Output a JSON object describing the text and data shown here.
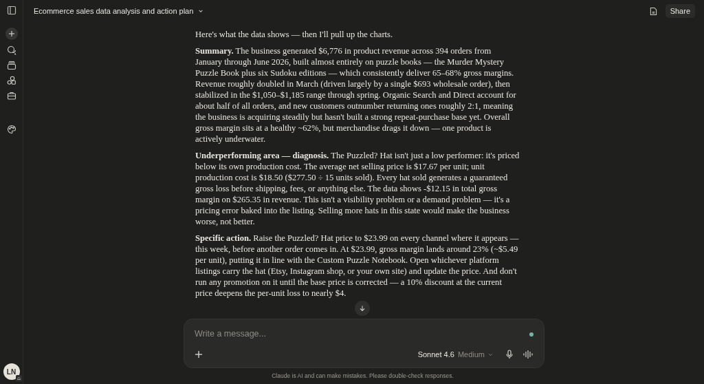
{
  "header": {
    "title": "Ecommerce sales data analysis and action plan",
    "share_label": "Share"
  },
  "sidebar": {
    "avatar_initials": "LN"
  },
  "message": {
    "paragraphs": [
      "Here's what the data shows — then I'll pull up the charts.",
      "**Summary.** The business generated $6,776 in product revenue across 394 orders from January through June 2026, built almost entirely on puzzle books — the Murder Mystery Puzzle Book plus six Sudoku editions — which consistently deliver 65–68% gross margins. Revenue roughly doubled in March (driven largely by a single $693 wholesale order), then stabilized in the $1,050–$1,185 range through spring. Organic Search and Direct account for about half of all orders, and new customers outnumber returning ones roughly 2:1, meaning the business is acquiring steadily but hasn't built a strong repeat-purchase base yet. Overall gross margin sits at a healthy ~62%, but merchandise drags it down — one product is actively underwater.",
      "**Underperforming area — diagnosis.** The Puzzled? Hat isn't just a low performer: it's priced below its own production cost. The average net selling price is $17.67 per unit; unit production cost is $18.50 ($277.50 ÷ 15 units sold). Every hat sold generates a guaranteed gross loss before shipping, fees, or anything else. The data shows -$12.15 in total gross margin on $265.35 in revenue. This isn't a visibility problem or a demand problem — it's a pricing error baked into the listing. Selling more hats in this state would make the business worse, not better.",
      "**Specific action.** Raise the Puzzled? Hat price to $23.99 on every channel where it appears — this week, before another order comes in. At $23.99, gross margin lands around 23% (~$5.49 per unit), putting it in line with the Custom Puzzle Notebook. Open whichever platform listings carry the hat (Etsy, Instagram shop, or your own site) and update the price. And don't run any promotion on it until the base price is corrected — a 10% discount at the current price deepens the per-unit loss to nearly $4."
    ]
  },
  "composer": {
    "placeholder": "Write a message...",
    "model": "Sonnet 4.6",
    "effort": "Medium"
  },
  "disclaimer": "Claude is AI and can make mistakes. Please double-check responses."
}
